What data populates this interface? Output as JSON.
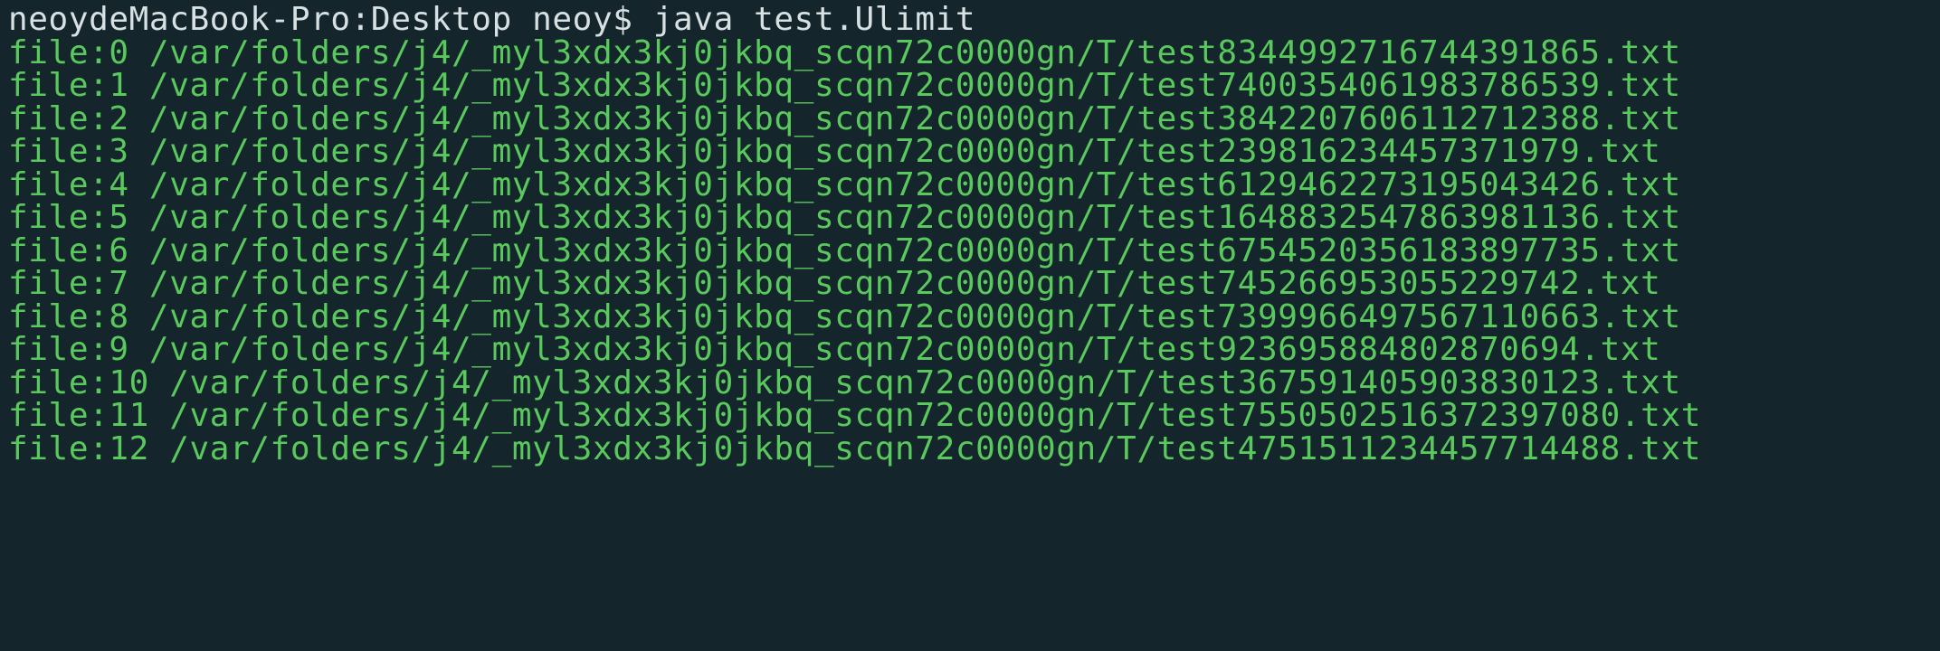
{
  "terminal": {
    "prompt": "neoydeMacBook-Pro:Desktop neoy$ java test.Ulimit",
    "output": [
      "file:0 /var/folders/j4/_myl3xdx3kj0jkbq_scqn72c0000gn/T/test8344992716744391865.txt",
      "file:1 /var/folders/j4/_myl3xdx3kj0jkbq_scqn72c0000gn/T/test7400354061983786539.txt",
      "file:2 /var/folders/j4/_myl3xdx3kj0jkbq_scqn72c0000gn/T/test3842207606112712388.txt",
      "file:3 /var/folders/j4/_myl3xdx3kj0jkbq_scqn72c0000gn/T/test239816234457371979.txt",
      "file:4 /var/folders/j4/_myl3xdx3kj0jkbq_scqn72c0000gn/T/test6129462273195043426.txt",
      "file:5 /var/folders/j4/_myl3xdx3kj0jkbq_scqn72c0000gn/T/test1648832547863981136.txt",
      "file:6 /var/folders/j4/_myl3xdx3kj0jkbq_scqn72c0000gn/T/test6754520356183897735.txt",
      "file:7 /var/folders/j4/_myl3xdx3kj0jkbq_scqn72c0000gn/T/test745266953055229742.txt",
      "file:8 /var/folders/j4/_myl3xdx3kj0jkbq_scqn72c0000gn/T/test7399966497567110663.txt",
      "file:9 /var/folders/j4/_myl3xdx3kj0jkbq_scqn72c0000gn/T/test923695884802870694.txt",
      "file:10 /var/folders/j4/_myl3xdx3kj0jkbq_scqn72c0000gn/T/test367591405903830123.txt",
      "file:11 /var/folders/j4/_myl3xdx3kj0jkbq_scqn72c0000gn/T/test7550502516372397080.txt",
      "file:12 /var/folders/j4/_myl3xdx3kj0jkbq_scqn72c0000gn/T/test4751511234457714488.txt"
    ],
    "colors": {
      "background": "#14262c",
      "prompt_text": "#d7e0e2",
      "output_text": "#5ac95d"
    }
  }
}
